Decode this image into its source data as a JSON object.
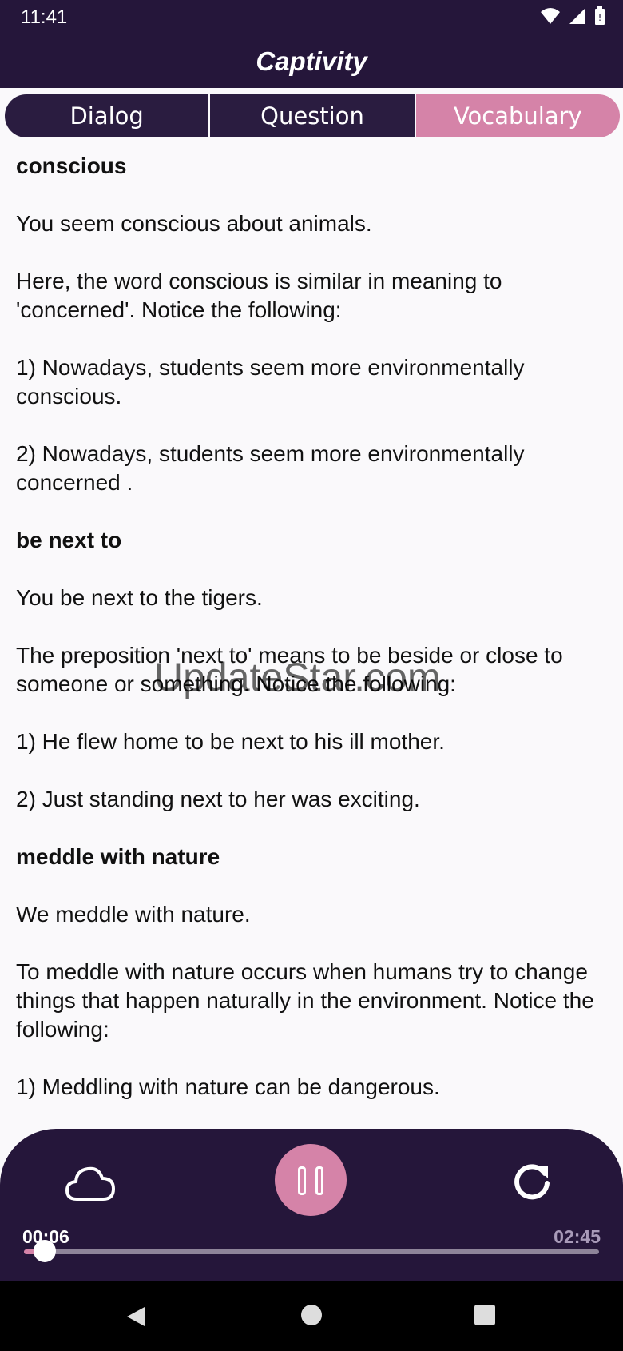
{
  "status_bar": {
    "time": "11:41"
  },
  "app_bar": {
    "title": "Captivity"
  },
  "tabs": [
    {
      "label": "Dialog",
      "active": false
    },
    {
      "label": "Question",
      "active": false
    },
    {
      "label": "Vocabulary",
      "active": true
    }
  ],
  "vocabulary": [
    {
      "term": "conscious",
      "paragraphs": [
        "You seem conscious about animals.",
        "Here, the word conscious is similar in meaning to 'concerned'. Notice the following:",
        "1) Nowadays, students seem more environmentally conscious.",
        "2) Nowadays, students seem more environmentally concerned ."
      ]
    },
    {
      "term": "be next to",
      "paragraphs": [
        "You be next to the tigers.",
        "The preposition 'next to' means to be beside or close to someone or something. Notice the following:",
        "1) He flew home to be next to his ill mother.",
        "2) Just standing next to her was exciting."
      ]
    },
    {
      "term": "meddle with nature",
      "paragraphs": [
        "We meddle with nature.",
        "To meddle with nature occurs when humans try to change things that happen naturally in the environment. Notice the following:",
        "1) Meddling with nature can be dangerous."
      ]
    }
  ],
  "watermark": "UpdateStar.com",
  "player": {
    "current_time": "00:06",
    "total_time": "02:45",
    "progress": 0.036,
    "accent_color": "#d583a8",
    "background_color": "#25163a",
    "icons": [
      "cloud-icon",
      "pause-icon",
      "replay-icon"
    ]
  },
  "nav_icons": [
    "back-icon",
    "home-icon",
    "recents-icon"
  ]
}
